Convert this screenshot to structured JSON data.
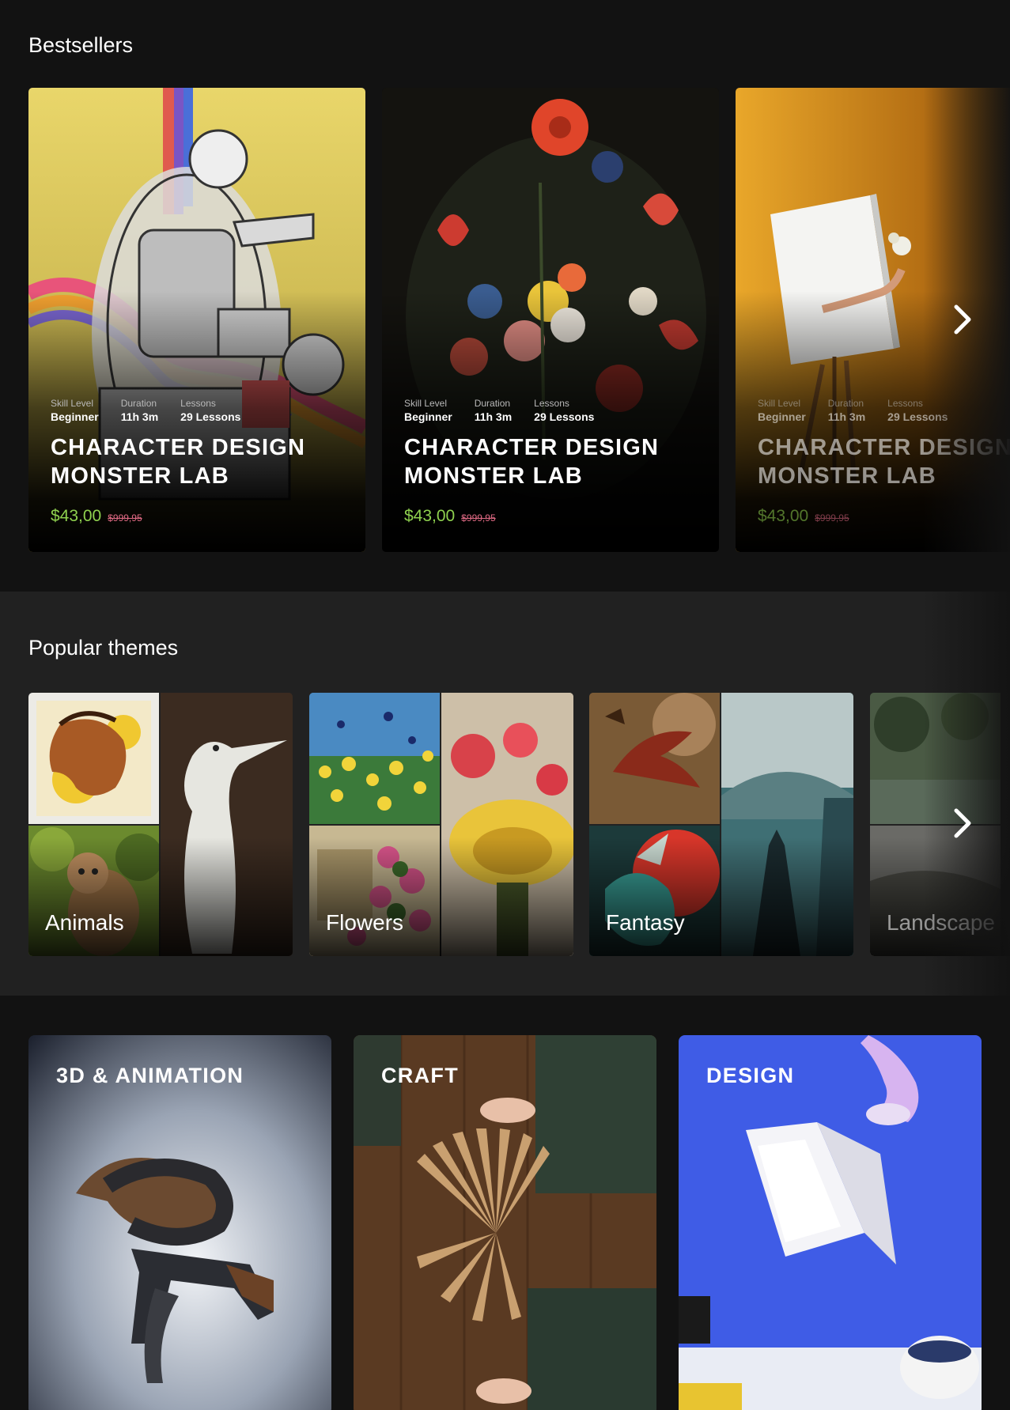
{
  "bestsellers": {
    "title": "Bestsellers",
    "cards": [
      {
        "skill_label": "Skill Level",
        "skill": "Beginner",
        "duration_label": "Duration",
        "duration": "11h 3m",
        "lessons_label": "Lessons",
        "lessons": "29 Lessons",
        "title": "CHARACTER DESIGN MONSTER LAB",
        "price": "$43,00",
        "old_price": "$999,95"
      },
      {
        "skill_label": "Skill Level",
        "skill": "Beginner",
        "duration_label": "Duration",
        "duration": "11h 3m",
        "lessons_label": "Lessons",
        "lessons": "29 Lessons",
        "title": "CHARACTER DESIGN MONSTER LAB",
        "price": "$43,00",
        "old_price": "$999,95"
      },
      {
        "skill_label": "Skill Level",
        "skill": "Beginner",
        "duration_label": "Duration",
        "duration": "11h 3m",
        "lessons_label": "Lessons",
        "lessons": "29 Lessons",
        "title": "CHARACTER DESIGN MONSTER LAB",
        "price": "$43,00",
        "old_price": "$999,95"
      }
    ]
  },
  "themes": {
    "title": "Popular themes",
    "items": [
      {
        "label": "Animals"
      },
      {
        "label": "Flowers"
      },
      {
        "label": "Fantasy"
      },
      {
        "label": "Landscape"
      }
    ]
  },
  "categories": {
    "items": [
      {
        "label": "3D & ANIMATION"
      },
      {
        "label": "CRAFT"
      },
      {
        "label": "DESIGN"
      }
    ]
  },
  "icons": {
    "next": "chevron-right-icon"
  },
  "colors": {
    "page_bg": "#121212",
    "themes_bg": "#212121",
    "price": "#8fd14f",
    "old_price": "#e06a84",
    "design_bg": "#3f5ce6"
  }
}
